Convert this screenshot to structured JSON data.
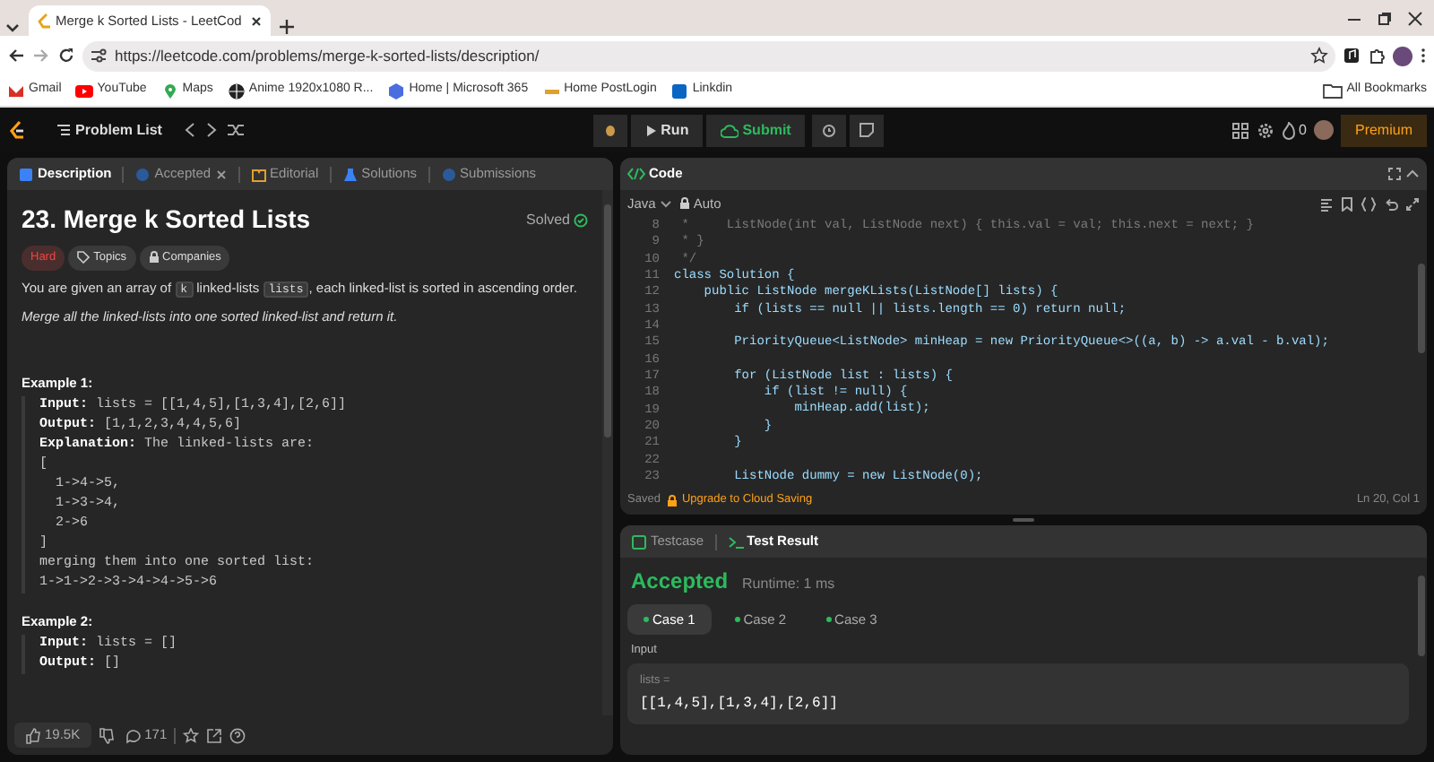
{
  "browser": {
    "tabs": [
      {
        "title": "Merge k Sorted Lists - LeetCod",
        "selected": true
      }
    ],
    "url": "https://leetcode.com/problems/merge-k-sorted-lists/description/",
    "bookmarks": [
      {
        "label": "Gmail",
        "kind": "mail"
      },
      {
        "label": "YouTube",
        "kind": "video"
      },
      {
        "label": "Maps",
        "kind": "pin"
      },
      {
        "label": "Anime 1920x1080 R...",
        "kind": "globe"
      },
      {
        "label": "Home | Microsoft 365",
        "kind": "hex"
      },
      {
        "label": "Home PostLogin",
        "kind": "bar"
      },
      {
        "label": "Linkdin",
        "kind": "square"
      }
    ],
    "all_bookmarks": "All Bookmarks"
  },
  "nav": {
    "problem_list": "Problem List",
    "run": "Run",
    "submit": "Submit",
    "streak": "0",
    "premium": "Premium"
  },
  "description": {
    "tabs": [
      {
        "label": "Description",
        "selected": true,
        "closable": false
      },
      {
        "label": "Accepted",
        "selected": false,
        "closable": true
      },
      {
        "label": "Editorial",
        "selected": false,
        "closable": false
      },
      {
        "label": "Solutions",
        "selected": false,
        "closable": false
      },
      {
        "label": "Submissions",
        "selected": false,
        "closable": false
      }
    ],
    "title": "23. Merge k Sorted Lists",
    "status": "Solved",
    "tags": [
      {
        "label": "Hard",
        "kind": "difficulty"
      },
      {
        "label": "Topics",
        "kind": "topics"
      },
      {
        "label": "Companies",
        "kind": "companies"
      }
    ],
    "intro": [
      {
        "text": "You are given an array of ",
        "kind": "text"
      },
      {
        "text": "k",
        "kind": "code"
      },
      {
        "text": " linked-lists ",
        "kind": "text"
      },
      {
        "text": "lists",
        "kind": "code"
      },
      {
        "text": ", each linked-list is sorted in ascending order.",
        "kind": "text"
      }
    ],
    "task": "Merge all the linked-lists into one sorted linked-list and return it.",
    "examples": [
      {
        "title": "Example 1:",
        "lines": [
          "**Input:** lists = [[1,4,5],[1,3,4],[2,6]]",
          "**Output:** [1,1,2,3,4,4,5,6]",
          "**Explanation:** The linked-lists are:",
          "[",
          "  1->4->5,",
          "  1->3->4,",
          "  2->6",
          "]",
          "merging them into one sorted list:",
          "1->1->2->3->4->4->5->6"
        ]
      },
      {
        "title": "Example 2:",
        "lines": [
          "**Input:** lists = []",
          "**Output:** []"
        ]
      }
    ],
    "likes": "19.5K",
    "comments": "171"
  },
  "code": {
    "title": "Code",
    "language": "Java",
    "mode": "Auto",
    "lines": [
      {
        "n": "8",
        "text": " *     ListNode(int val, ListNode next) { this.val = val; this.next = next; }",
        "kind": "comment"
      },
      {
        "n": "9",
        "text": " * }",
        "kind": "comment"
      },
      {
        "n": "10",
        "text": " */",
        "kind": "comment"
      },
      {
        "n": "11",
        "text": "class Solution {",
        "kind": "code"
      },
      {
        "n": "12",
        "text": "    public ListNode mergeKLists(ListNode[] lists) {",
        "kind": "code"
      },
      {
        "n": "13",
        "text": "        if (lists == null || lists.length == 0) return null;",
        "kind": "code"
      },
      {
        "n": "14",
        "kind": "code"
      },
      {
        "n": "15",
        "text": "        PriorityQueue<ListNode> minHeap = new PriorityQueue<>((a, b) -> a.val - b.val);",
        "kind": "code"
      },
      {
        "n": "16",
        "kind": "code"
      },
      {
        "n": "17",
        "text": "        for (ListNode list : lists) {",
        "kind": "code"
      },
      {
        "n": "18",
        "text": "            if (list != null) {",
        "kind": "code"
      },
      {
        "n": "19",
        "text": "                minHeap.add(list);",
        "kind": "code"
      },
      {
        "n": "20",
        "text": "            }",
        "kind": "code"
      },
      {
        "n": "21",
        "text": "        }",
        "kind": "code"
      },
      {
        "n": "22",
        "kind": "code"
      },
      {
        "n": "23",
        "text": "        ListNode dummy = new ListNode(0);",
        "kind": "code"
      }
    ],
    "saved": "Saved",
    "upgrade": "Upgrade to Cloud Saving",
    "position": "Ln 20, Col 1"
  },
  "result": {
    "tabs": [
      {
        "label": "Testcase",
        "selected": false
      },
      {
        "label": "Test Result",
        "selected": true
      }
    ],
    "verdict": "Accepted",
    "runtime": "Runtime: 1 ms",
    "cases": [
      {
        "label": "Case 1",
        "selected": true
      },
      {
        "label": "Case 2",
        "selected": false
      },
      {
        "label": "Case 3",
        "selected": false
      }
    ],
    "input_label": "Input",
    "variable": "lists =",
    "value": "[[1,4,5],[1,3,4],[2,6]]"
  }
}
